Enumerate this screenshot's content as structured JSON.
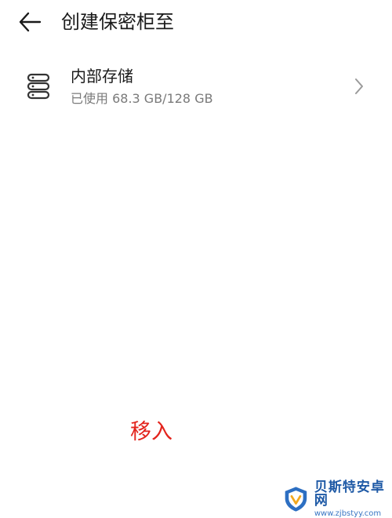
{
  "header": {
    "title": "创建保密柜至"
  },
  "storage": {
    "name": "内部存储",
    "usage": "已使用 68.3 GB/128 GB"
  },
  "action": {
    "label": "移入",
    "color": "#e3231c"
  },
  "watermark": {
    "brand": "贝斯特安卓网",
    "url": "www.zjbstyy.com"
  },
  "icons": {
    "back": "back-arrow-icon",
    "storage": "storage-stack-icon",
    "chevron": "chevron-right-icon"
  }
}
